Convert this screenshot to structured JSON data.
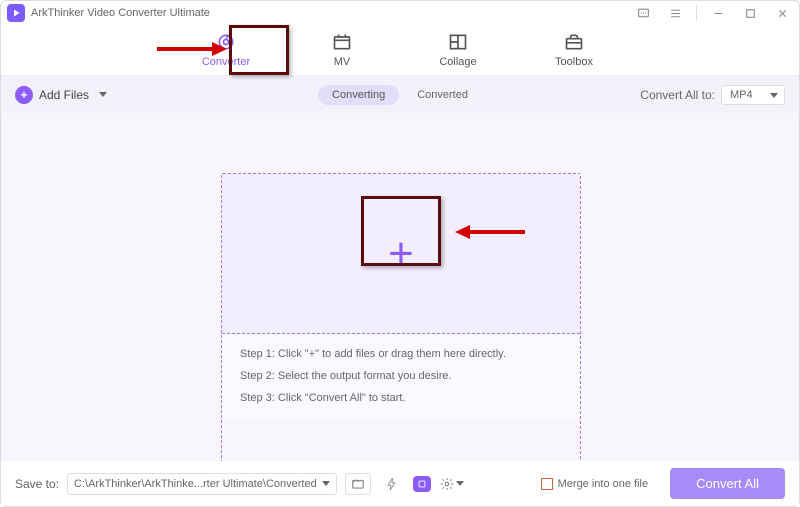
{
  "app": {
    "title": "ArkThinker Video Converter Ultimate"
  },
  "tabs": {
    "converter": "Converter",
    "mv": "MV",
    "collage": "Collage",
    "toolbox": "Toolbox"
  },
  "toolbar": {
    "add_files_label": "Add Files",
    "segment_converting": "Converting",
    "segment_converted": "Converted",
    "convert_all_to_label": "Convert All to:",
    "format_value": "MP4"
  },
  "dropzone": {
    "step1": "Step 1: Click \"+\" to add files or drag them here directly.",
    "step2": "Step 2: Select the output format you desire.",
    "step3": "Step 3: Click \"Convert All\" to start."
  },
  "footer": {
    "save_to_label": "Save to:",
    "save_path": "C:\\ArkThinker\\ArkThinke...rter Ultimate\\Converted",
    "merge_label": "Merge into one file",
    "convert_all_btn": "Convert All"
  }
}
